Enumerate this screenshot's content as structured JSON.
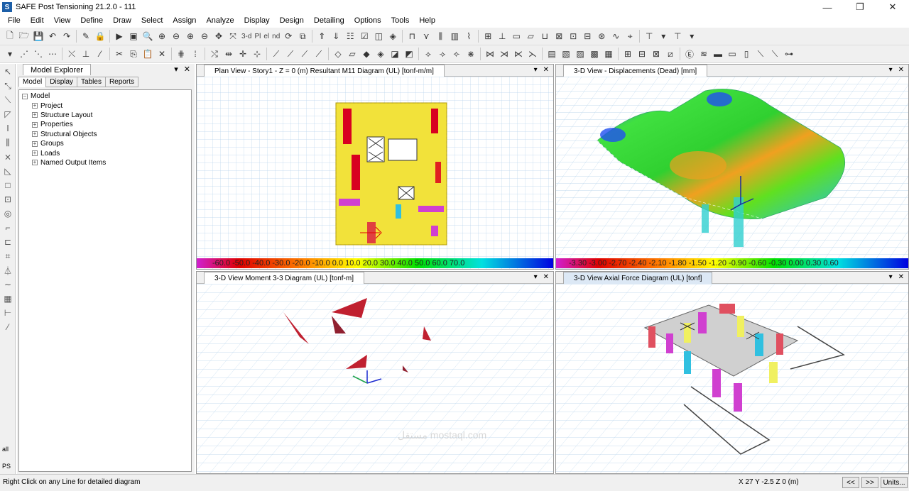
{
  "window": {
    "title": "SAFE Post Tensioning 21.2.0 - 111",
    "app_icon": "S",
    "controls": [
      "—",
      "❐",
      "✕"
    ]
  },
  "menu": [
    "File",
    "Edit",
    "View",
    "Define",
    "Draw",
    "Select",
    "Assign",
    "Analyze",
    "Display",
    "Design",
    "Detailing",
    "Options",
    "Tools",
    "Help"
  ],
  "toolbar": {
    "three_d": "3-d",
    "plan": "Pl",
    "elev": "el",
    "nd": "nd"
  },
  "explorer": {
    "title": "Model Explorer",
    "tabs": [
      "Model",
      "Display",
      "Tables",
      "Reports"
    ],
    "root": "Model",
    "items": [
      "Project",
      "Structure Layout",
      "Properties",
      "Structural Objects",
      "Groups",
      "Loads",
      "Named Output Items"
    ]
  },
  "views": {
    "plan": {
      "title": "Plan View - Story1 - Z = 0 (m)   Resultant M11 Diagram   (UL)  [tonf-m/m]",
      "scale": "-60.0 -50.0 -40.0 -30.0 -20.0 -10.0  0.0  10.0  20.0  30.0  40.0  50.0  60.0 70.0"
    },
    "displacement": {
      "title": "3-D View  - Displacements (Dead)  [mm]",
      "scale": "-3.30 -3.00 -2.70 -2.40 -2.10 -1.80 -1.50 -1.20 -0.90 -0.60 -0.30 0.00  0.30 0.60"
    },
    "moment": {
      "title": "3-D View   Moment 3-3 Diagram   (UL)  [tonf-m]"
    },
    "axial": {
      "title": "3-D View   Axial Force Diagram   (UL)  [tonf]"
    }
  },
  "status": {
    "hint": "Right Click on any Line for detailed diagram",
    "coords": "X 27  Y -2.5  Z 0 (m)",
    "prev": "<<",
    "next": ">>",
    "units": "Units..."
  },
  "left_tools": {
    "all": "all",
    "ps": "PS"
  },
  "watermark": "مستقل mostaql.com",
  "colors": {
    "accent": "#1d5fa8",
    "slab": "#f2e23a"
  }
}
